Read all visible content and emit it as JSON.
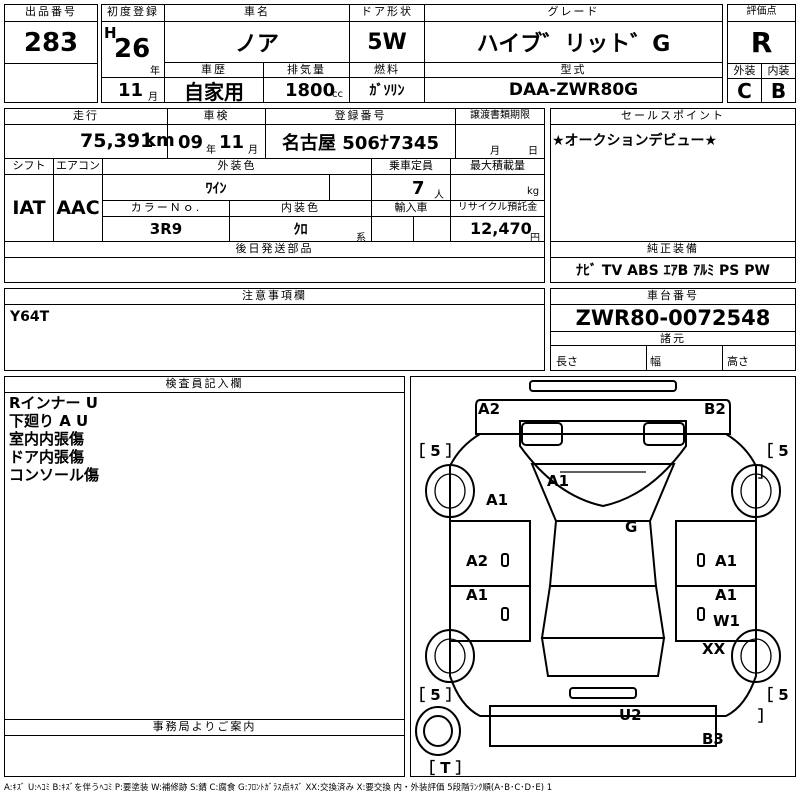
{
  "header": {
    "lot_label": "出品番号",
    "lot_value": "283",
    "first_reg_label": "初度登録",
    "era": "H",
    "first_reg_year": "26",
    "year_unit": "年",
    "first_reg_month": "11",
    "month_unit": "月",
    "car_name_label": "車名",
    "car_name": "ノア",
    "door_label": "ドア形状",
    "door_value": "5W",
    "grade_label": "グレード",
    "grade_value": "ハイブ゛リット゛G",
    "score_label": "評価点",
    "score_value": "R",
    "history_label": "車歴",
    "history_value": "自家用",
    "displacement_label": "排気量",
    "displacement_value": "1800",
    "displacement_unit": "cc",
    "fuel_label": "燃料",
    "fuel_value": "ｶﾞｿﾘﾝ",
    "model_label": "型式",
    "model_value": "DAA-ZWR80G",
    "exterior_label": "外装",
    "exterior_value": "C",
    "interior_label": "内装",
    "interior_value": "B"
  },
  "row2": {
    "mileage_label": "走行",
    "mileage_value": "75,391",
    "mileage_unit": "km",
    "inspection_label": "車検",
    "inspection_year": "09",
    "inspection_year_unit": "年",
    "inspection_month": "11",
    "inspection_month_unit": "月",
    "plate_label": "登録番号",
    "plate_value": "名古屋 506ﾅ7345",
    "transfer_label": "譲渡書類期限",
    "transfer_month_unit": "月",
    "transfer_day_unit": "日",
    "sales_point_label": "セールスポイント",
    "sales_point_value": "★オークションデビュー★"
  },
  "row3": {
    "shift_label": "シフト",
    "shift_value": "IAT",
    "ac_label": "エアコン",
    "ac_value": "AAC",
    "exterior_color_label": "外装色",
    "exterior_color_value": "ﾜｲﾝ",
    "capacity_label": "乗車定員",
    "capacity_value": "7",
    "capacity_unit": "人",
    "max_load_label": "最大積載量",
    "max_load_unit": "kg",
    "color_no_label": "カラーＮｏ.",
    "color_no_value": "3R9",
    "interior_color_label": "内装色",
    "interior_color_value": "ｸﾛ",
    "interior_color_unit": "系",
    "import_label": "輸入車",
    "recycle_label": "リサイクル預託金",
    "recycle_value": "12,470",
    "recycle_unit": "円"
  },
  "later_parts_label": "後日発送部品",
  "genuine_label": "純正装備",
  "genuine_value": "ﾅﾋﾞ  TV  ABS ｴｱB ｱﾙﾐ PS PW",
  "caution_label": "注意事項欄",
  "caution_value": "Y64T",
  "chassis_label": "車台番号",
  "chassis_value": "ZWR80-0072548",
  "specs_label": "諸元",
  "length_label": "長さ",
  "width_label": "幅",
  "height_label": "高さ",
  "inspector_label": "検査員記入欄",
  "inspector_notes": [
    "Rインナー U",
    "下廻り A U",
    "室内内張傷",
    "ドア内張傷",
    "コンソール傷"
  ],
  "office_label": "事務局よりご案内",
  "diagram": {
    "tire_front_left": "［ 5 ］",
    "tire_front_right": "［ 5 ］",
    "tire_rear_left": "［ 5 ］",
    "tire_rear_right": "［ 5 ］",
    "spare": "［ T ］",
    "marks": {
      "front_bumper_left": "A2",
      "front_bumper_right": "B2",
      "hood": "A1",
      "front_fender_left": "A1",
      "roof": "G",
      "front_door_left": "A2",
      "front_door_right": "A1",
      "rear_door_left": "A1",
      "rear_door_right": "A1",
      "rear_door_right2": "W1",
      "rear_fender_right": "XX",
      "rear_gate": "U2",
      "rear_bumper_right": "B3"
    }
  },
  "legend": "A:ｷｽﾞ U:ﾍｺﾐ B:ｷｽﾞを伴うﾍｺﾐ P:要塗装 W:補修跡 S:錆 C:腐食 G:ﾌﾛﾝﾄｶﾞﾗｽ点ｷｽﾞ XX:交換済み X:要交換  内・外装評価  5段階ﾗﾝｸ順(A･B･C･D･E) 1"
}
